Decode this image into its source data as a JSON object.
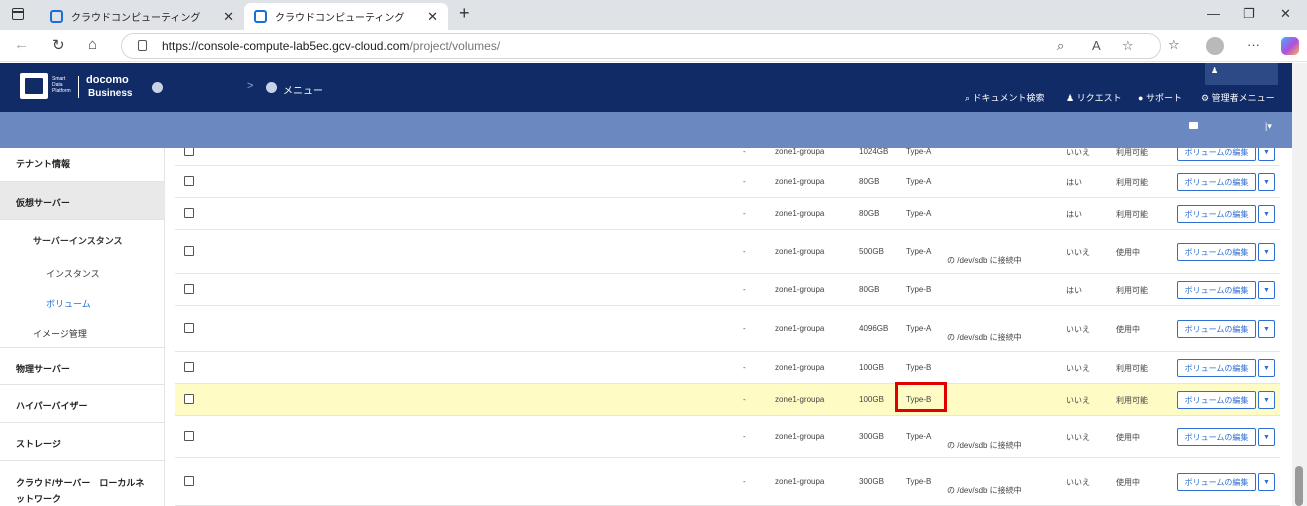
{
  "browser": {
    "tabs": [
      {
        "title": "クラウドコンピューティング",
        "active": false
      },
      {
        "title": "クラウドコンピューティング",
        "active": true
      }
    ],
    "url_host": "https://console-compute-lab5ec.gcv-cloud.com",
    "url_path": "/project/volumes/"
  },
  "header": {
    "logo_line1": "Smart",
    "logo_line2": "Data",
    "logo_line3": "Platform",
    "brand": "docomo",
    "brand_sub": "Business",
    "menu_label": "メニュー",
    "links": {
      "doc_search": "ドキュメント検索",
      "request": "リクエスト",
      "support": "サポート",
      "admin_menu": "管理者メニュー"
    }
  },
  "sidebar": {
    "tenant_info": "テナント情報",
    "virtual_server": "仮想サーバー",
    "server_instance": "サーバーインスタンス",
    "instance": "インスタンス",
    "volume": "ボリューム",
    "image_mgmt": "イメージ管理",
    "physical_server": "物理サーバー",
    "hypervisor": "ハイパーバイザー",
    "storage": "ストレージ",
    "cloud_server_local_line1": "クラウド/サーバー　ローカルネ",
    "cloud_server_local_line2": "ットワーク"
  },
  "volumes": {
    "edit_label": "ボリュームの編集",
    "caret": "▼",
    "rows": [
      {
        "dash": "-",
        "zone": "zone1-groupa",
        "size": "1024GB",
        "type": "Type-A",
        "attached": "",
        "bootable": "いいえ",
        "status": "利用可能",
        "highlight": false
      },
      {
        "dash": "-",
        "zone": "zone1-groupa",
        "size": "80GB",
        "type": "Type-A",
        "attached": "",
        "bootable": "はい",
        "status": "利用可能",
        "highlight": false
      },
      {
        "dash": "-",
        "zone": "zone1-groupa",
        "size": "80GB",
        "type": "Type-A",
        "attached": "",
        "bootable": "はい",
        "status": "利用可能",
        "highlight": false
      },
      {
        "dash": "-",
        "zone": "zone1-groupa",
        "size": "500GB",
        "type": "Type-A",
        "attached": "の /dev/sdb に接続中",
        "bootable": "いいえ",
        "status": "使用中",
        "highlight": false
      },
      {
        "dash": "-",
        "zone": "zone1-groupa",
        "size": "80GB",
        "type": "Type-B",
        "attached": "",
        "bootable": "はい",
        "status": "利用可能",
        "highlight": false
      },
      {
        "dash": "-",
        "zone": "zone1-groupa",
        "size": "4096GB",
        "type": "Type-A",
        "attached": "の /dev/sdb に接続中",
        "bootable": "いいえ",
        "status": "使用中",
        "highlight": false
      },
      {
        "dash": "-",
        "zone": "zone1-groupa",
        "size": "100GB",
        "type": "Type-B",
        "attached": "",
        "bootable": "いいえ",
        "status": "利用可能",
        "highlight": false
      },
      {
        "dash": "-",
        "zone": "zone1-groupa",
        "size": "100GB",
        "type": "Type-B",
        "attached": "",
        "bootable": "いいえ",
        "status": "利用可能",
        "highlight": true
      },
      {
        "dash": "-",
        "zone": "zone1-groupa",
        "size": "300GB",
        "type": "Type-A",
        "attached": "の /dev/sdb に接続中",
        "bootable": "いいえ",
        "status": "使用中",
        "highlight": false
      },
      {
        "dash": "-",
        "zone": "zone1-groupa",
        "size": "300GB",
        "type": "Type-B",
        "attached": "の /dev/sdb に接続中",
        "bootable": "いいえ",
        "status": "使用中",
        "highlight": false
      }
    ]
  }
}
